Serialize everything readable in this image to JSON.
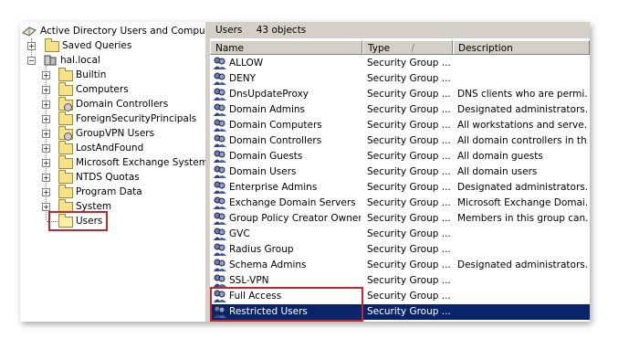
{
  "tree": {
    "root_label": "Active Directory Users and Computer",
    "saved_queries": "Saved Queries",
    "domain": "hal.local",
    "items": [
      {
        "label": "Builtin",
        "icon": "folder-icon"
      },
      {
        "label": "Computers",
        "icon": "folder-icon"
      },
      {
        "label": "Domain Controllers",
        "icon": "ou-folder-icon"
      },
      {
        "label": "ForeignSecurityPrincipals",
        "icon": "folder-icon"
      },
      {
        "label": "GroupVPN Users",
        "icon": "ou-folder-icon"
      },
      {
        "label": "LostAndFound",
        "icon": "folder-icon"
      },
      {
        "label": "Microsoft Exchange System O",
        "icon": "folder-icon"
      },
      {
        "label": "NTDS Quotas",
        "icon": "folder-icon"
      },
      {
        "label": "Program Data",
        "icon": "folder-icon"
      },
      {
        "label": "System",
        "icon": "folder-icon"
      },
      {
        "label": "Users",
        "icon": "open-folder-icon"
      }
    ]
  },
  "list": {
    "title": "Users",
    "count": "43 objects",
    "columns": {
      "name": "Name",
      "type": "Type",
      "sort_indicator": "/",
      "description": "Description"
    },
    "rows": [
      {
        "name": "ALLOW",
        "type": "Security Group ...",
        "description": ""
      },
      {
        "name": "DENY",
        "type": "Security Group ...",
        "description": ""
      },
      {
        "name": "DnsUpdateProxy",
        "type": "Security Group ...",
        "description": "DNS clients who are permi..."
      },
      {
        "name": "Domain Admins",
        "type": "Security Group ...",
        "description": "Designated administrators..."
      },
      {
        "name": "Domain Computers",
        "type": "Security Group ...",
        "description": "All workstations and serve..."
      },
      {
        "name": "Domain Controllers",
        "type": "Security Group ...",
        "description": "All domain controllers in th..."
      },
      {
        "name": "Domain Guests",
        "type": "Security Group ...",
        "description": "All domain guests"
      },
      {
        "name": "Domain Users",
        "type": "Security Group ...",
        "description": "All domain users"
      },
      {
        "name": "Enterprise Admins",
        "type": "Security Group ...",
        "description": "Designated administrators..."
      },
      {
        "name": "Exchange Domain Servers",
        "type": "Security Group ...",
        "description": "Microsoft Exchange Domai..."
      },
      {
        "name": "Group Policy Creator Owners",
        "type": "Security Group ...",
        "description": "Members in this group can..."
      },
      {
        "name": "GVC",
        "type": "Security Group ...",
        "description": ""
      },
      {
        "name": "Radius Group",
        "type": "Security Group ...",
        "description": ""
      },
      {
        "name": "Schema Admins",
        "type": "Security Group ...",
        "description": "Designated administrators..."
      },
      {
        "name": "SSL-VPN",
        "type": "Security Group ...",
        "description": ""
      },
      {
        "name": "Full Access",
        "type": "Security Group ...",
        "description": ""
      },
      {
        "name": "Restricted Users",
        "type": "Security Group ...",
        "description": ""
      }
    ]
  },
  "colors": {
    "selection": "#0a246a",
    "highlight_box": "#c0282d",
    "chrome": "#d4d0c8"
  }
}
